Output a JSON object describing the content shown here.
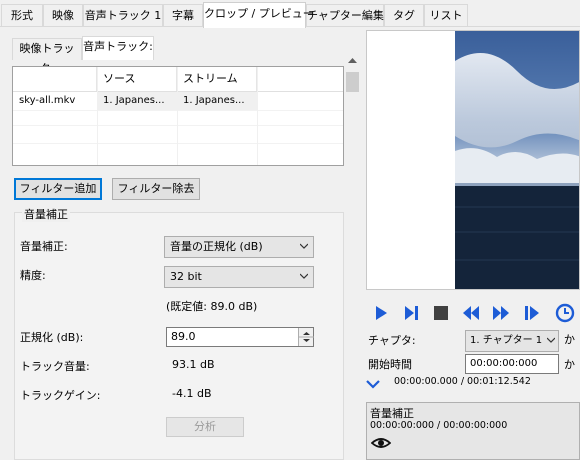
{
  "tabs": [
    {
      "label": "形式"
    },
    {
      "label": "映像"
    },
    {
      "label": "音声トラック 1"
    },
    {
      "label": "字幕"
    },
    {
      "label": "クロップ / プレビュー"
    },
    {
      "label": "チャプター編集"
    },
    {
      "label": "タグ"
    },
    {
      "label": "リスト"
    }
  ],
  "subtabs": [
    {
      "label": "映像トラック:"
    },
    {
      "label": "音声トラック:"
    }
  ],
  "grid": {
    "headers": [
      "",
      "ソース",
      "ストリーム"
    ],
    "row": [
      "sky-all.mkv",
      "1. Japanes...",
      "1. Japanes..."
    ]
  },
  "buttons": {
    "add_filter": "フィルター追加",
    "remove_filter": "フィルター除去",
    "analyze": "分析"
  },
  "group": {
    "title": "音量補正",
    "volume_label": "音量補正:",
    "volume_value": "音量の正規化 (dB)",
    "precision_label": "精度:",
    "precision_value": "32 bit",
    "default_note": "(既定値: 89.0 dB)",
    "normalize_label": "正規化 (dB):",
    "normalize_value": "89.0",
    "track_volume_label": "トラック音量:",
    "track_volume_value": "93.1 dB",
    "track_gain_label": "トラックゲイン:",
    "track_gain_value": "-4.1 dB"
  },
  "player": {
    "chapter_label": "チャプタ:",
    "chapter_value": "1. チャプター 1",
    "chapter_trail": "か",
    "start_label": "開始時間",
    "start_value": "00:00:00:000",
    "start_trail": "か",
    "time_readout": "00:00:00.000 / 00:01:12.542"
  },
  "filter_panel": {
    "title": "音量補正",
    "time": "00:00:00:000 / 00:00:00:000"
  },
  "colors": {
    "accent": "#1d5cd6",
    "play": "#1d5cd6",
    "stop": "#404040"
  }
}
